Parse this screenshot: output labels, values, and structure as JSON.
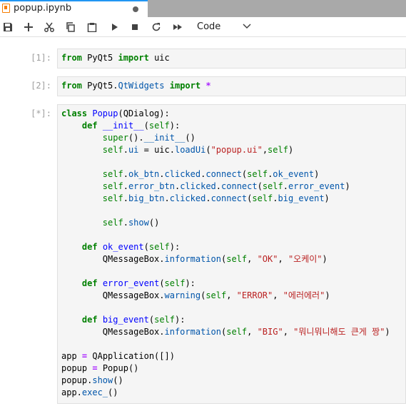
{
  "tab": {
    "title": "popup.ipynb"
  },
  "toolbar": {
    "cell_type": "Code",
    "icons": [
      "save-icon",
      "add-cell-icon",
      "cut-icon",
      "copy-icon",
      "paste-icon",
      "run-icon",
      "stop-icon",
      "restart-icon",
      "run-all-icon",
      "chevron-down-icon"
    ]
  },
  "cells": [
    {
      "prompt": "[1]:",
      "lines": [
        [
          [
            "kw",
            "from"
          ],
          [
            "t",
            " PyQt5 "
          ],
          [
            "kw",
            "import"
          ],
          [
            "t",
            " uic"
          ]
        ]
      ]
    },
    {
      "prompt": "[2]:",
      "lines": [
        [
          [
            "kw",
            "from"
          ],
          [
            "t",
            " PyQt5."
          ],
          [
            "attr",
            "QtWidgets"
          ],
          [
            "t",
            " "
          ],
          [
            "kw",
            "import"
          ],
          [
            "t",
            " "
          ],
          [
            "op",
            "*"
          ]
        ]
      ]
    },
    {
      "prompt": "[*]:",
      "lines": [
        [
          [
            "kw",
            "class"
          ],
          [
            "t",
            " "
          ],
          [
            "def",
            "Popup"
          ],
          [
            "t",
            "(QDialog):"
          ]
        ],
        [
          [
            "t",
            "    "
          ],
          [
            "kw",
            "def"
          ],
          [
            "t",
            " "
          ],
          [
            "def",
            "__init__"
          ],
          [
            "t",
            "("
          ],
          [
            "self",
            "self"
          ],
          [
            "t",
            "):"
          ]
        ],
        [
          [
            "t",
            "        "
          ],
          [
            "bi",
            "super"
          ],
          [
            "t",
            "()."
          ],
          [
            "attr",
            "__init__"
          ],
          [
            "t",
            "()"
          ]
        ],
        [
          [
            "t",
            "        "
          ],
          [
            "self",
            "self"
          ],
          [
            "t",
            "."
          ],
          [
            "attr",
            "ui"
          ],
          [
            "t",
            " = uic."
          ],
          [
            "attr",
            "loadUi"
          ],
          [
            "t",
            "("
          ],
          [
            "str",
            "\"popup.ui\""
          ],
          [
            "t",
            ","
          ],
          [
            "self",
            "self"
          ],
          [
            "t",
            ")"
          ]
        ],
        [
          [
            "t",
            ""
          ]
        ],
        [
          [
            "t",
            "        "
          ],
          [
            "self",
            "self"
          ],
          [
            "t",
            "."
          ],
          [
            "attr",
            "ok_btn"
          ],
          [
            "t",
            "."
          ],
          [
            "attr",
            "clicked"
          ],
          [
            "t",
            "."
          ],
          [
            "attr",
            "connect"
          ],
          [
            "t",
            "("
          ],
          [
            "self",
            "self"
          ],
          [
            "t",
            "."
          ],
          [
            "attr",
            "ok_event"
          ],
          [
            "t",
            ")"
          ]
        ],
        [
          [
            "t",
            "        "
          ],
          [
            "self",
            "self"
          ],
          [
            "t",
            "."
          ],
          [
            "attr",
            "error_btn"
          ],
          [
            "t",
            "."
          ],
          [
            "attr",
            "clicked"
          ],
          [
            "t",
            "."
          ],
          [
            "attr",
            "connect"
          ],
          [
            "t",
            "("
          ],
          [
            "self",
            "self"
          ],
          [
            "t",
            "."
          ],
          [
            "attr",
            "error_event"
          ],
          [
            "t",
            ")"
          ]
        ],
        [
          [
            "t",
            "        "
          ],
          [
            "self",
            "self"
          ],
          [
            "t",
            "."
          ],
          [
            "attr",
            "big_btn"
          ],
          [
            "t",
            "."
          ],
          [
            "attr",
            "clicked"
          ],
          [
            "t",
            "."
          ],
          [
            "attr",
            "connect"
          ],
          [
            "t",
            "("
          ],
          [
            "self",
            "self"
          ],
          [
            "t",
            "."
          ],
          [
            "attr",
            "big_event"
          ],
          [
            "t",
            ")"
          ]
        ],
        [
          [
            "t",
            ""
          ]
        ],
        [
          [
            "t",
            "        "
          ],
          [
            "self",
            "self"
          ],
          [
            "t",
            "."
          ],
          [
            "attr",
            "show"
          ],
          [
            "t",
            "()"
          ]
        ],
        [
          [
            "t",
            ""
          ]
        ],
        [
          [
            "t",
            "    "
          ],
          [
            "kw",
            "def"
          ],
          [
            "t",
            " "
          ],
          [
            "def",
            "ok_event"
          ],
          [
            "t",
            "("
          ],
          [
            "self",
            "self"
          ],
          [
            "t",
            "):"
          ]
        ],
        [
          [
            "t",
            "        QMessageBox."
          ],
          [
            "attr",
            "information"
          ],
          [
            "t",
            "("
          ],
          [
            "self",
            "self"
          ],
          [
            "t",
            ", "
          ],
          [
            "str",
            "\"OK\""
          ],
          [
            "t",
            ", "
          ],
          [
            "str",
            "\"오케이\""
          ],
          [
            "t",
            ")"
          ]
        ],
        [
          [
            "t",
            ""
          ]
        ],
        [
          [
            "t",
            "    "
          ],
          [
            "kw",
            "def"
          ],
          [
            "t",
            " "
          ],
          [
            "def",
            "error_event"
          ],
          [
            "t",
            "("
          ],
          [
            "self",
            "self"
          ],
          [
            "t",
            "):"
          ]
        ],
        [
          [
            "t",
            "        QMessageBox."
          ],
          [
            "attr",
            "warning"
          ],
          [
            "t",
            "("
          ],
          [
            "self",
            "self"
          ],
          [
            "t",
            ", "
          ],
          [
            "str",
            "\"ERROR\""
          ],
          [
            "t",
            ", "
          ],
          [
            "str",
            "\"에러에러\""
          ],
          [
            "t",
            ")"
          ]
        ],
        [
          [
            "t",
            ""
          ]
        ],
        [
          [
            "t",
            "    "
          ],
          [
            "kw",
            "def"
          ],
          [
            "t",
            " "
          ],
          [
            "def",
            "big_event"
          ],
          [
            "t",
            "("
          ],
          [
            "self",
            "self"
          ],
          [
            "t",
            "):"
          ]
        ],
        [
          [
            "t",
            "        QMessageBox."
          ],
          [
            "attr",
            "information"
          ],
          [
            "t",
            "("
          ],
          [
            "self",
            "self"
          ],
          [
            "t",
            ", "
          ],
          [
            "str",
            "\"BIG\""
          ],
          [
            "t",
            ", "
          ],
          [
            "str",
            "\"뭐니뭐니해도 큰게 짱\""
          ],
          [
            "t",
            ")"
          ]
        ],
        [
          [
            "t",
            ""
          ]
        ],
        [
          [
            "t",
            "app "
          ],
          [
            "op",
            "="
          ],
          [
            "t",
            " QApplication([])"
          ]
        ],
        [
          [
            "t",
            "popup "
          ],
          [
            "op",
            "="
          ],
          [
            "t",
            " Popup()"
          ]
        ],
        [
          [
            "t",
            "popup."
          ],
          [
            "attr",
            "show"
          ],
          [
            "t",
            "()"
          ]
        ],
        [
          [
            "t",
            "app."
          ],
          [
            "attr",
            "exec_"
          ],
          [
            "t",
            "()"
          ]
        ]
      ]
    }
  ]
}
